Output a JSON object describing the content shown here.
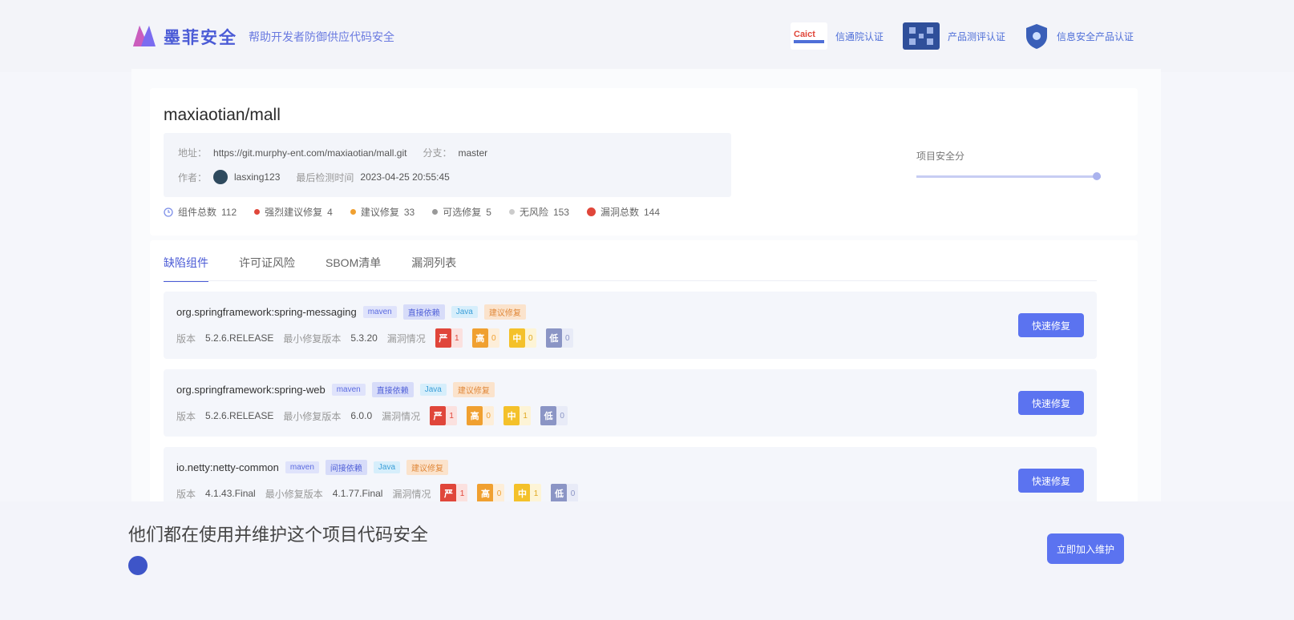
{
  "header": {
    "logo_text": "墨菲安全",
    "slogan": "帮助开发者防御供应代码安全",
    "badges": [
      {
        "label": "信通院认证",
        "icon": "caict-logo-icon"
      },
      {
        "label": "产品测评认证",
        "icon": "qr-code-icon"
      },
      {
        "label": "信息安全产品认证",
        "icon": "shield-icon"
      }
    ]
  },
  "repo": {
    "title": "maxiaotian/mall",
    "address_label": "地址：",
    "address": "https://git.murphy-ent.com/maxiaotian/mall.git",
    "branch_label": "分支：",
    "branch": "master",
    "owner_label": "作者：",
    "owner": "lasxing123",
    "last_detect_label": "最后检测时间",
    "last_detect": "2023-04-25 20:55:45",
    "right_label": "项目安全分",
    "progress": 1.0
  },
  "stats": [
    {
      "label": "组件总数",
      "value": "112",
      "color": "#7d8fe8"
    },
    {
      "label": "强烈建议修复",
      "value": "4",
      "color": "#e0463a"
    },
    {
      "label": "建议修复",
      "value": "33",
      "color": "#f0a030"
    },
    {
      "label": "可选修复",
      "value": "5",
      "color": "#999999"
    },
    {
      "label": "无风险",
      "value": "153",
      "color": "#cccccc"
    },
    {
      "label": "漏洞总数",
      "value": "144",
      "color": "#e0463a"
    }
  ],
  "tabs": [
    {
      "label": "缺陷组件",
      "active": true
    },
    {
      "label": "许可证风险",
      "active": false
    },
    {
      "label": "SBOM清单",
      "active": false
    },
    {
      "label": "漏洞列表",
      "active": false
    }
  ],
  "dependencies": [
    {
      "name": "org.springframework:spring-messaging",
      "tags": [
        "maven",
        "直接依赖",
        "Java",
        "建议修复"
      ],
      "version_label": "版本",
      "version": "5.2.6.RELEASE",
      "min_fix_label": "最小修复版本",
      "min_fix": "5.3.20",
      "vuln_label": "漏洞情况",
      "severity": [
        {
          "level": "严",
          "count": "1",
          "color": "#e0463a"
        },
        {
          "level": "高",
          "count": "0",
          "color": "#f0a030"
        },
        {
          "level": "中",
          "count": "0",
          "color": "#f4c12a"
        },
        {
          "level": "低",
          "count": "0",
          "color": "#8b95c5"
        }
      ],
      "button": "快速修复"
    },
    {
      "name": "org.springframework:spring-web",
      "tags": [
        "maven",
        "直接依赖",
        "Java",
        "建议修复"
      ],
      "version_label": "版本",
      "version": "5.2.6.RELEASE",
      "min_fix_label": "最小修复版本",
      "min_fix": "6.0.0",
      "vuln_label": "漏洞情况",
      "severity": [
        {
          "level": "严",
          "count": "1",
          "color": "#e0463a"
        },
        {
          "level": "高",
          "count": "0",
          "color": "#f0a030"
        },
        {
          "level": "中",
          "count": "1",
          "color": "#f4c12a"
        },
        {
          "level": "低",
          "count": "0",
          "color": "#8b95c5"
        }
      ],
      "button": "快速修复"
    },
    {
      "name": "io.netty:netty-common",
      "tags": [
        "maven",
        "间接依赖",
        "Java",
        "建议修复"
      ],
      "version_label": "版本",
      "version": "4.1.43.Final",
      "min_fix_label": "最小修复版本",
      "min_fix": "4.1.77.Final",
      "vuln_label": "漏洞情况",
      "severity": [
        {
          "level": "严",
          "count": "1",
          "color": "#e0463a"
        },
        {
          "level": "高",
          "count": "0",
          "color": "#f0a030"
        },
        {
          "level": "中",
          "count": "1",
          "color": "#f4c12a"
        },
        {
          "level": "低",
          "count": "0",
          "color": "#8b95c5"
        }
      ],
      "button": "快速修复"
    }
  ],
  "footer": {
    "title": "他们都在使用并维护这个项目代码安全",
    "button": "立即加入维护"
  }
}
